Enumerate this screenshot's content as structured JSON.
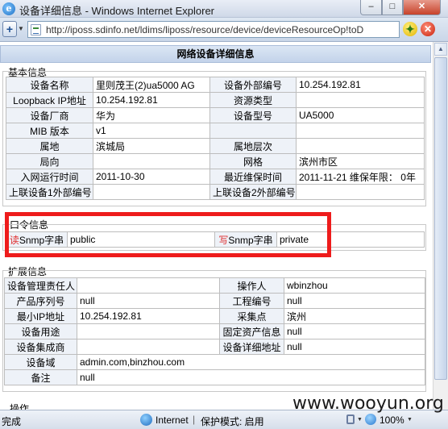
{
  "window": {
    "title": "设备详细信息 - Windows Internet Explorer",
    "min_glyph": "–",
    "max_glyph": "□",
    "close_glyph": "✕"
  },
  "addressbar": {
    "url": "http://iposs.sdinfo.net/ldims/liposs/resource/device/deviceResourceOp!toD"
  },
  "page": {
    "header": "网络设备详细信息",
    "basic": {
      "title": "基本信息",
      "rows": [
        [
          "设备名称",
          "里则茂王(2)ua5000 AG",
          "设备外部编号",
          "10.254.192.81"
        ],
        [
          "Loopback IP地址",
          "10.254.192.81",
          "资源类型",
          ""
        ],
        [
          "设备厂商",
          "华为",
          "设备型号",
          "UA5000"
        ],
        [
          "MIB 版本",
          "v1",
          "",
          ""
        ],
        [
          "属地",
          "滨城局",
          "属地层次",
          ""
        ],
        [
          "局向",
          "",
          "网格",
          "滨州市区"
        ],
        [
          "入网运行时间",
          "2011-10-30",
          "最近维保时间",
          "2011-11-21  维保年限：  0年"
        ],
        [
          "上联设备1外部编号",
          "",
          "上联设备2外部编号",
          ""
        ]
      ]
    },
    "password": {
      "title": "口令信息",
      "read_label": "读Snmp字串",
      "read_value": "public",
      "write_label": "写Snmp字串",
      "write_value": "private",
      "label_accent": "#e03030"
    },
    "extended": {
      "title": "扩展信息",
      "rows": [
        [
          "设备管理责任人",
          "",
          "操作人",
          "wbinzhou"
        ],
        [
          "产品序列号",
          "null",
          "工程编号",
          "null"
        ],
        [
          "最小IP地址",
          "10.254.192.81",
          "采集点",
          "滨州"
        ],
        [
          "设备用途",
          "",
          "固定资产信息",
          "null"
        ],
        [
          "设备集成商",
          "",
          "设备详细地址",
          "null"
        ],
        [
          "设备域",
          "admin.com,binzhou.com"
        ],
        [
          "备注",
          "null"
        ]
      ]
    },
    "next_section_title": "操作"
  },
  "statusbar": {
    "status": "完成",
    "zone": "Internet",
    "separator": "|",
    "protected_mode": "保护模式: 启用",
    "zoom": "100%"
  },
  "watermark": "www.wooyun.org",
  "colors": {
    "highlight_box": "#ee1c1c",
    "label_bg": "#eef2f8",
    "header_bg": "#c3d3ea"
  }
}
